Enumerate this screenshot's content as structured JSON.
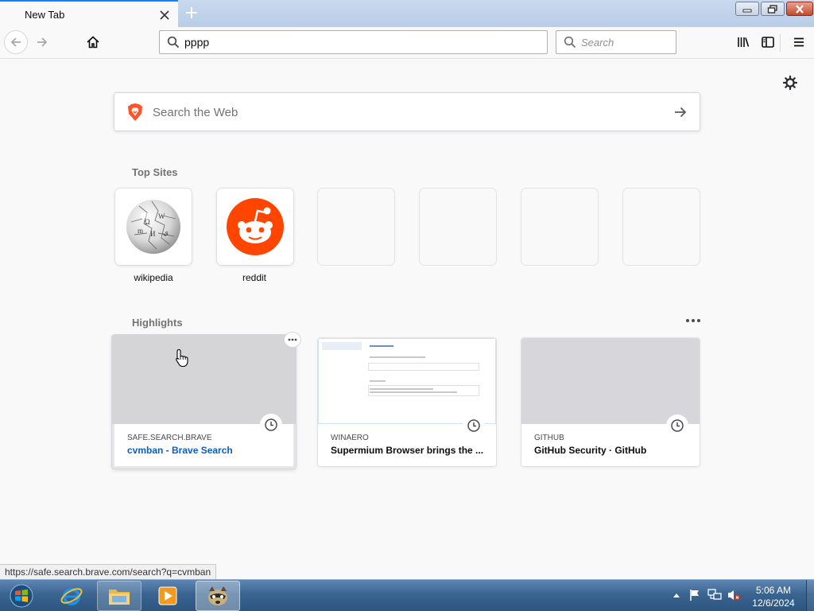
{
  "browser": {
    "tab": {
      "title": "New Tab",
      "close_icon": "close-icon"
    },
    "new_tab_icon": "plus-icon",
    "window_controls": [
      "minimize-icon",
      "maximize-icon",
      "close-icon"
    ],
    "address_bar": {
      "value": "pppp"
    },
    "search_bar": {
      "placeholder": "Search"
    }
  },
  "newtab": {
    "web_search": {
      "placeholder": "Search the Web"
    },
    "top_sites": {
      "title": "Top Sites",
      "sites": [
        {
          "label": "wikipedia"
        },
        {
          "label": "reddit"
        },
        {
          "label": ""
        },
        {
          "label": ""
        },
        {
          "label": ""
        },
        {
          "label": ""
        }
      ]
    },
    "highlights": {
      "title": "Highlights",
      "cards": [
        {
          "host": "SAFE.SEARCH.BRAVE",
          "title": "cvmban - Brave Search"
        },
        {
          "host": "WINAERO",
          "title": "Supermium Browser brings the ..."
        },
        {
          "host": "GITHUB",
          "title": "GitHub Security · GitHub"
        }
      ]
    }
  },
  "status_url": "https://safe.search.brave.com/search?q=cvmban",
  "taskbar": {
    "apps": [
      "internet-explorer-icon",
      "file-explorer-icon",
      "media-player-icon",
      "browser-app-icon"
    ],
    "clock": {
      "time": "5:06 AM",
      "date": "12/6/2024"
    }
  },
  "colors": {
    "accent": "#0a84ff",
    "reddit": "#ff4500",
    "link": "#0a5ec2"
  }
}
